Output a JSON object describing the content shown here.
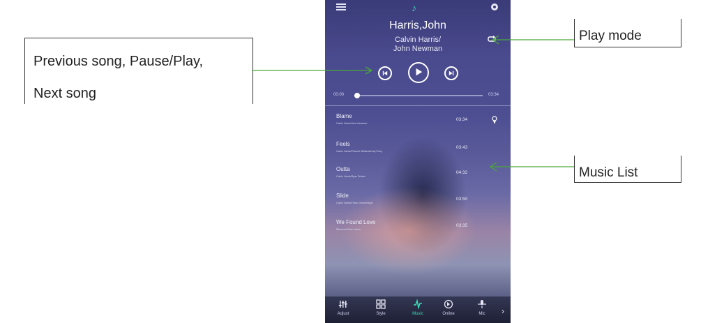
{
  "annotations": {
    "controls": {
      "line1": "Previous song, Pause/Play,",
      "line2": "Next song"
    },
    "play_mode": "Play mode",
    "music_list": "Music List"
  },
  "colors": {
    "accent": "#37e0b6",
    "arrow": "#4aa838"
  },
  "app": {
    "topbar": {
      "menu_icon": "menu-icon",
      "logo_icon": "music-note-icon",
      "settings_icon": "gear-icon"
    },
    "now_playing": {
      "title": "Harris,John",
      "artist_line1": "Calvin Harris/",
      "artist_line2": "John Newman",
      "playmode_icon": "repeat-icon"
    },
    "progress": {
      "elapsed": "00:00",
      "total": "03:34",
      "fraction": 0.02
    },
    "tracks": [
      {
        "name": "Blame",
        "artist": "Calvin Harris/John Newman",
        "duration": "03:34"
      },
      {
        "name": "Feels",
        "artist": "Calvin Harris/Pharrell Williams/Katy Perry",
        "duration": "03:43"
      },
      {
        "name": "Outta",
        "artist": "Calvin Harris/Ryan Tedder",
        "duration": "04:32"
      },
      {
        "name": "Slide",
        "artist": "Calvin Harris/Frank Ocean/Migos",
        "duration": "03:50"
      },
      {
        "name": "We Found Love",
        "artist": "Rihanna/Calvin Harris",
        "duration": "03:35"
      }
    ],
    "nav": [
      {
        "label": "Adjust",
        "icon": "equalizer-icon"
      },
      {
        "label": "Style",
        "icon": "grid-icon"
      },
      {
        "label": "Music",
        "icon": "music-note-icon"
      },
      {
        "label": "Online",
        "icon": "online-icon"
      },
      {
        "label": "Mic",
        "icon": "mic-icon"
      }
    ],
    "active_nav": "Music"
  }
}
